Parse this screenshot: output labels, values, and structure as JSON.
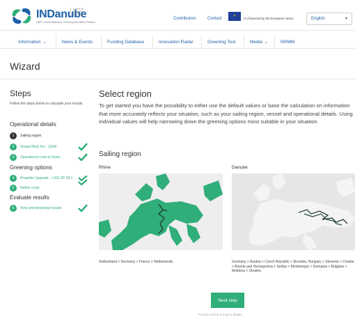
{
  "header": {
    "logo_name": "INDanube",
    "logo_tagline": "GRIP | Inland Waterway Greening Information Platform",
    "logo_sub": "Centre for Innovative Transport",
    "links": [
      "Contributors",
      "Contact"
    ],
    "eu_text": "Co-financed by the European Union",
    "language": "English"
  },
  "nav": {
    "items": [
      {
        "label": "Information",
        "dropdown": true
      },
      {
        "label": "News & Events",
        "dropdown": false
      },
      {
        "label": "Funding Database",
        "dropdown": false
      },
      {
        "label": "Innovation Radar",
        "dropdown": false
      },
      {
        "label": "Greening Tool",
        "dropdown": false
      },
      {
        "label": "Media",
        "dropdown": true
      },
      {
        "label": "NRMM",
        "dropdown": false
      }
    ]
  },
  "page_title": "Wizard",
  "steps": {
    "title": "Steps",
    "description": "Follow the steps below to calculate your results.",
    "groups": [
      {
        "title": "Operational details",
        "items": [
          {
            "num": "1",
            "label": "Sailing region",
            "active": true,
            "done": false
          },
          {
            "num": "2",
            "label": "Vessel 85x9.2m - 1269t",
            "active": false,
            "done": true
          },
          {
            "num": "3",
            "label": "Operational costs & hours",
            "active": false,
            "done": true
          }
        ]
      },
      {
        "title": "Greening options",
        "items": [
          {
            "num": "4",
            "label": "Propeller Upgrade... LNG DF 50-25",
            "active": false,
            "done": true
          },
          {
            "num": "5",
            "label": "Refine costs",
            "active": false,
            "done": true
          }
        ]
      },
      {
        "title": "Evaluate results",
        "items": [
          {
            "num": "6",
            "label": "View and download results",
            "active": false,
            "done": true
          }
        ]
      }
    ]
  },
  "main": {
    "title": "Select region",
    "intro": "To get started you have the possibility to either use the default values or base the calculation on information that more accurately reflects your situation, such as your sailing region, vessel and operational details. Using individual values will help narrowing down the greening options most suitable in your situation.",
    "sailing_title": "Sailing region",
    "regions": [
      {
        "name": "Rhine",
        "caption": "Switzerland > Germany > France > Netherlands.",
        "selected": true
      },
      {
        "name": "Danube",
        "caption": "Germany > Austria > Czech Republic > Slovakia, Hungary > Slovenia > Croatia > Bosnia and Herzegovina > Serbia > Montenegro > Romania > Bulgaria > Moldova > Ukraine.",
        "selected": false
      }
    ],
    "next_button": "Next step",
    "footer_hint": "Provide vessel & engine details"
  },
  "colors": {
    "brand_blue": "#1d5fa7",
    "accent_green": "#2fae7a",
    "active_step": "#333333"
  }
}
